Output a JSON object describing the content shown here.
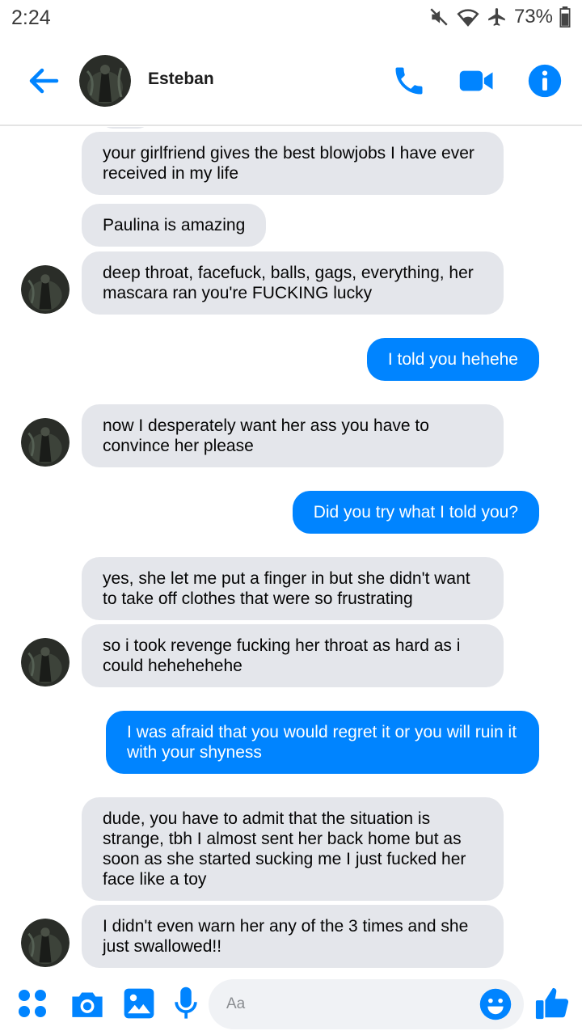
{
  "status": {
    "time": "2:24",
    "battery": "73%",
    "icons": [
      "mute-icon",
      "wifi-icon",
      "airplane-icon",
      "battery-icon"
    ]
  },
  "header": {
    "contact_name": "Esteban",
    "icons": [
      "back-arrow-icon",
      "phone-icon",
      "video-camera-icon",
      "info-icon"
    ],
    "accent_color": "#0084ff"
  },
  "messages": [
    {
      "direction": "incoming",
      "text": "your girlfriend gives the best blowjobs I have ever received in my life"
    },
    {
      "direction": "incoming",
      "text": "Paulina is amazing"
    },
    {
      "direction": "incoming",
      "text": "deep throat, facefuck, balls, gags, everything, her mascara ran you're FUCKING lucky"
    },
    {
      "direction": "outgoing",
      "text": "I told you hehehe"
    },
    {
      "direction": "incoming",
      "text": "now I desperately want her ass you have to convince her please"
    },
    {
      "direction": "outgoing",
      "text": "Did you try what I told you?"
    },
    {
      "direction": "incoming",
      "text": "yes, she let me put a finger in but she didn't want to take off clothes that were so frustrating"
    },
    {
      "direction": "incoming",
      "text": "so i took revenge fucking her throat as hard as i could hehehehehe"
    },
    {
      "direction": "outgoing",
      "text": "I was afraid that you would regret it or you will ruin it with your shyness"
    },
    {
      "direction": "incoming",
      "text": "dude, you have to admit that the situation is strange, tbh I almost sent her back home but as soon as she started sucking me I just fucked her face like a toy"
    },
    {
      "direction": "incoming",
      "text": "I didn't even warn her any of the 3 times and she just swallowed!!"
    }
  ],
  "composer": {
    "placeholder": "Aa",
    "icons": [
      "apps-icon",
      "camera-icon",
      "gallery-icon",
      "microphone-icon",
      "emoji-icon",
      "thumbs-up-icon"
    ]
  },
  "colors": {
    "incoming_bubble": "#e4e6eb",
    "outgoing_bubble": "#0084ff"
  }
}
